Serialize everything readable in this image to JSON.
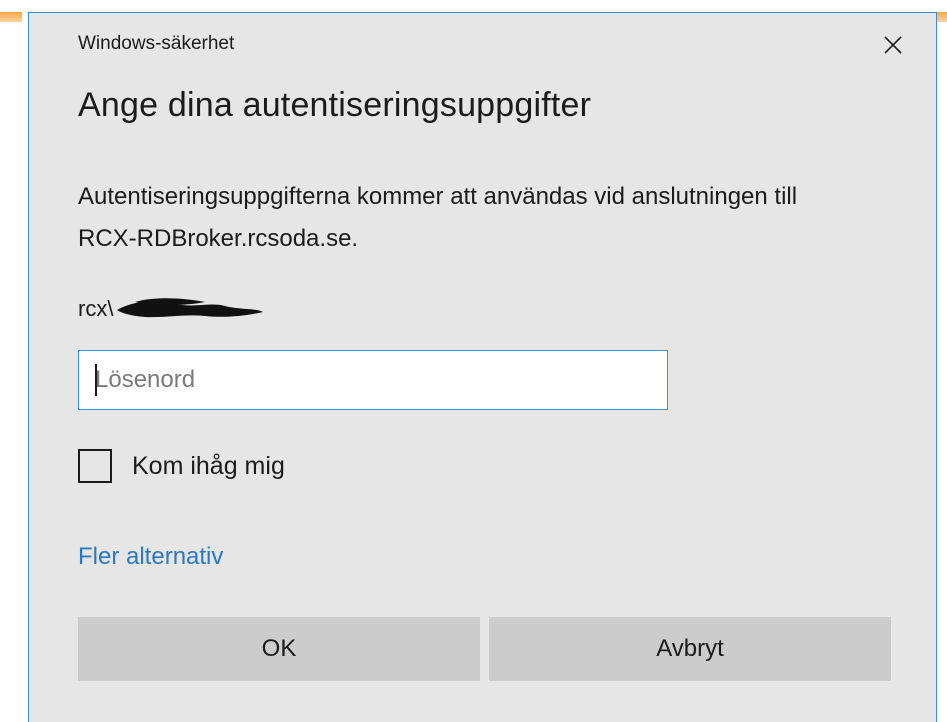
{
  "dialog": {
    "window_title": "Windows-säkerhet",
    "heading": "Ange dina autentiseringsuppgifter",
    "description": "Autentiseringsuppgifterna kommer att användas vid anslutningen till RCX-RDBroker.rcsoda.se.",
    "username_prefix": "rcx\\",
    "password": {
      "placeholder": "Lösenord",
      "value": ""
    },
    "remember_label": "Kom ihåg mig",
    "remember_checked": false,
    "more_options_label": "Fler alternativ",
    "ok_label": "OK",
    "cancel_label": "Avbryt",
    "close_icon": "close-icon"
  },
  "colors": {
    "dialog_bg": "#e6e6e6",
    "accent_border": "#3c8fce",
    "link": "#2a78c6",
    "button_bg": "#cccccc"
  }
}
